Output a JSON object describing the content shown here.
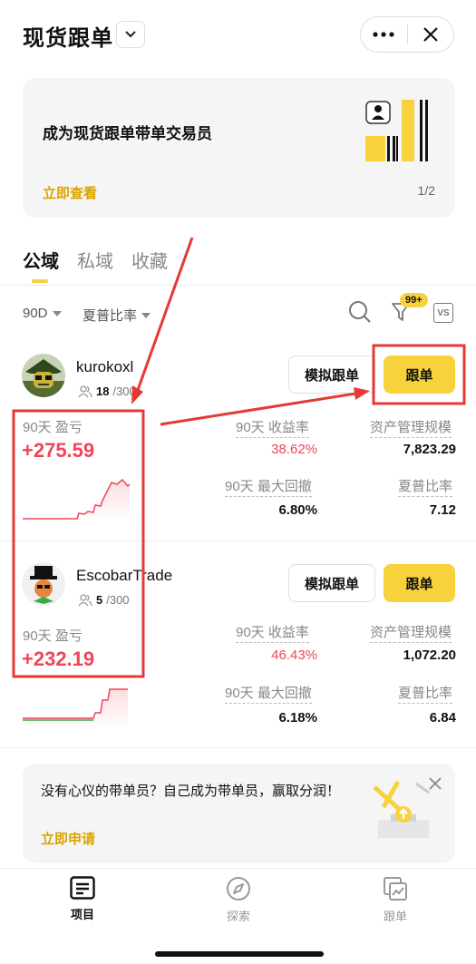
{
  "header": {
    "title": "现货跟单"
  },
  "banner": {
    "title": "成为现货跟单带单交易员",
    "link": "立即查看",
    "page": "1/2"
  },
  "tabs": [
    {
      "label": "公域",
      "active": true
    },
    {
      "label": "私域",
      "active": false
    },
    {
      "label": "收藏",
      "active": false
    }
  ],
  "filters": {
    "period": "90D",
    "sort": "夏普比率",
    "badge": "99+",
    "vs": "VS"
  },
  "stat_labels": {
    "pnl": "90天 盈亏",
    "roi": "90天 收益率",
    "aum": "资产管理规模",
    "drawdown": "90天 最大回撤",
    "sharpe": "夏普比率"
  },
  "buttons": {
    "simulate": "模拟跟单",
    "follow": "跟单"
  },
  "traders": [
    {
      "name": "kurokoxl",
      "followers": "18",
      "capacity": "/300",
      "pnl": "+275.59",
      "roi": "38.62%",
      "aum": "7,823.29",
      "drawdown": "6.80%",
      "sharpe": "7.12"
    },
    {
      "name": "EscobarTrade",
      "followers": "5",
      "capacity": "/300",
      "pnl": "+232.19",
      "roi": "46.43%",
      "aum": "1,072.20",
      "drawdown": "6.18%",
      "sharpe": "6.84"
    }
  ],
  "promo": {
    "text": "没有心仪的带单员？自己成为带单员，赢取分润！",
    "link": "立即申请"
  },
  "nav": [
    {
      "label": "项目",
      "icon": "list-icon",
      "active": true
    },
    {
      "label": "探索",
      "icon": "compass-icon",
      "active": false
    },
    {
      "label": "跟单",
      "icon": "copy-chart-icon",
      "active": false
    }
  ],
  "colors": {
    "accent": "#f7d23c",
    "link": "#d9a400",
    "profit": "#f0445a",
    "annotation": "#e53935"
  }
}
